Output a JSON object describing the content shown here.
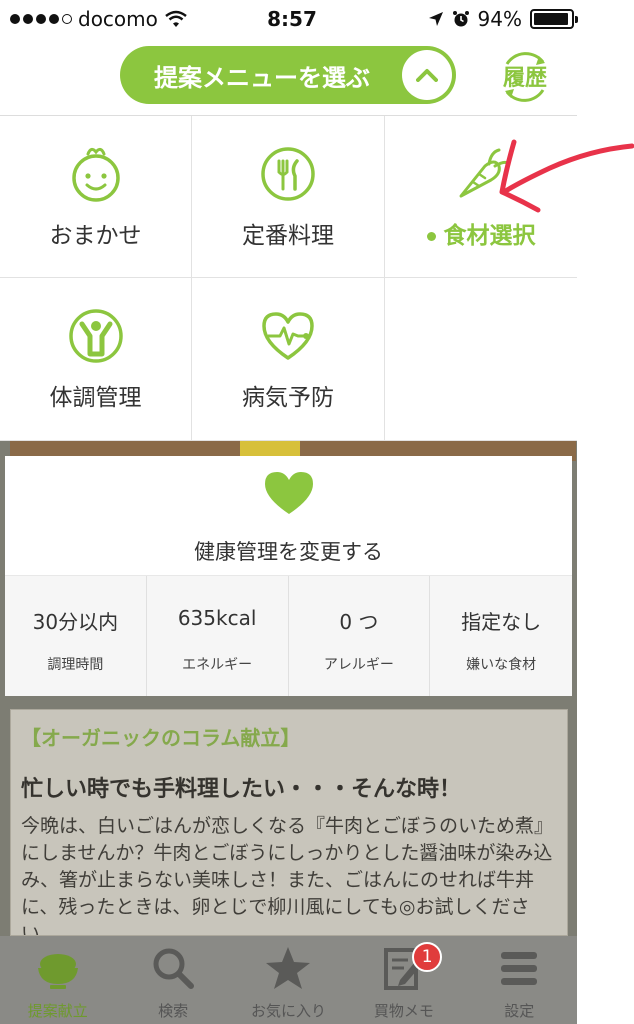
{
  "status": {
    "carrier": "docomo",
    "time": "8:57",
    "battery": "94%"
  },
  "header": {
    "pill_label": "提案メニューを選ぶ",
    "history_label": "履歴"
  },
  "menu": {
    "items": [
      {
        "label": "おまかせ",
        "icon": "smiling-turnip-icon"
      },
      {
        "label": "定番料理",
        "icon": "fork-knife-icon"
      },
      {
        "label": "食材選択",
        "icon": "carrot-icon",
        "active": true
      },
      {
        "label": "体調管理",
        "icon": "person-arms-up-icon"
      },
      {
        "label": "病気予防",
        "icon": "heart-pulse-icon"
      }
    ]
  },
  "card": {
    "title": "健康管理を変更する",
    "stats": [
      {
        "value": "30分以内",
        "label": "調理時間"
      },
      {
        "value": "635kcal",
        "label": "エネルギー"
      },
      {
        "value": "0 つ",
        "label": "アレルギー"
      },
      {
        "value": "指定なし",
        "label": "嫌いな食材"
      }
    ]
  },
  "article": {
    "tag": "【オーガニックのコラム献立】",
    "headline": "忙しい時でも手料理したい・・・そんな時！",
    "body": "今晩は、白いごはんが恋しくなる『牛肉とごぼうのいため煮』にしませんか？牛肉とごぼうにしっかりとした醤油味が染み込み、箸が止まらない美味しさ！また、ごはんにのせれば牛丼に、残ったときは、卵とじで柳川風にしても◎お試しください。"
  },
  "tabbar": {
    "tabs": [
      {
        "label": "提案献立",
        "icon": "rice-bowl-icon",
        "active": true
      },
      {
        "label": "検索",
        "icon": "magnifier-icon"
      },
      {
        "label": "お気に入り",
        "icon": "star-icon"
      },
      {
        "label": "買物メモ",
        "icon": "memo-pencil-icon",
        "badge": "1"
      },
      {
        "label": "設定",
        "icon": "hamburger-menu-icon"
      }
    ]
  },
  "colors": {
    "accent": "#8cc63f",
    "annotation": "#e8334a",
    "badge": "#e03c3c"
  }
}
